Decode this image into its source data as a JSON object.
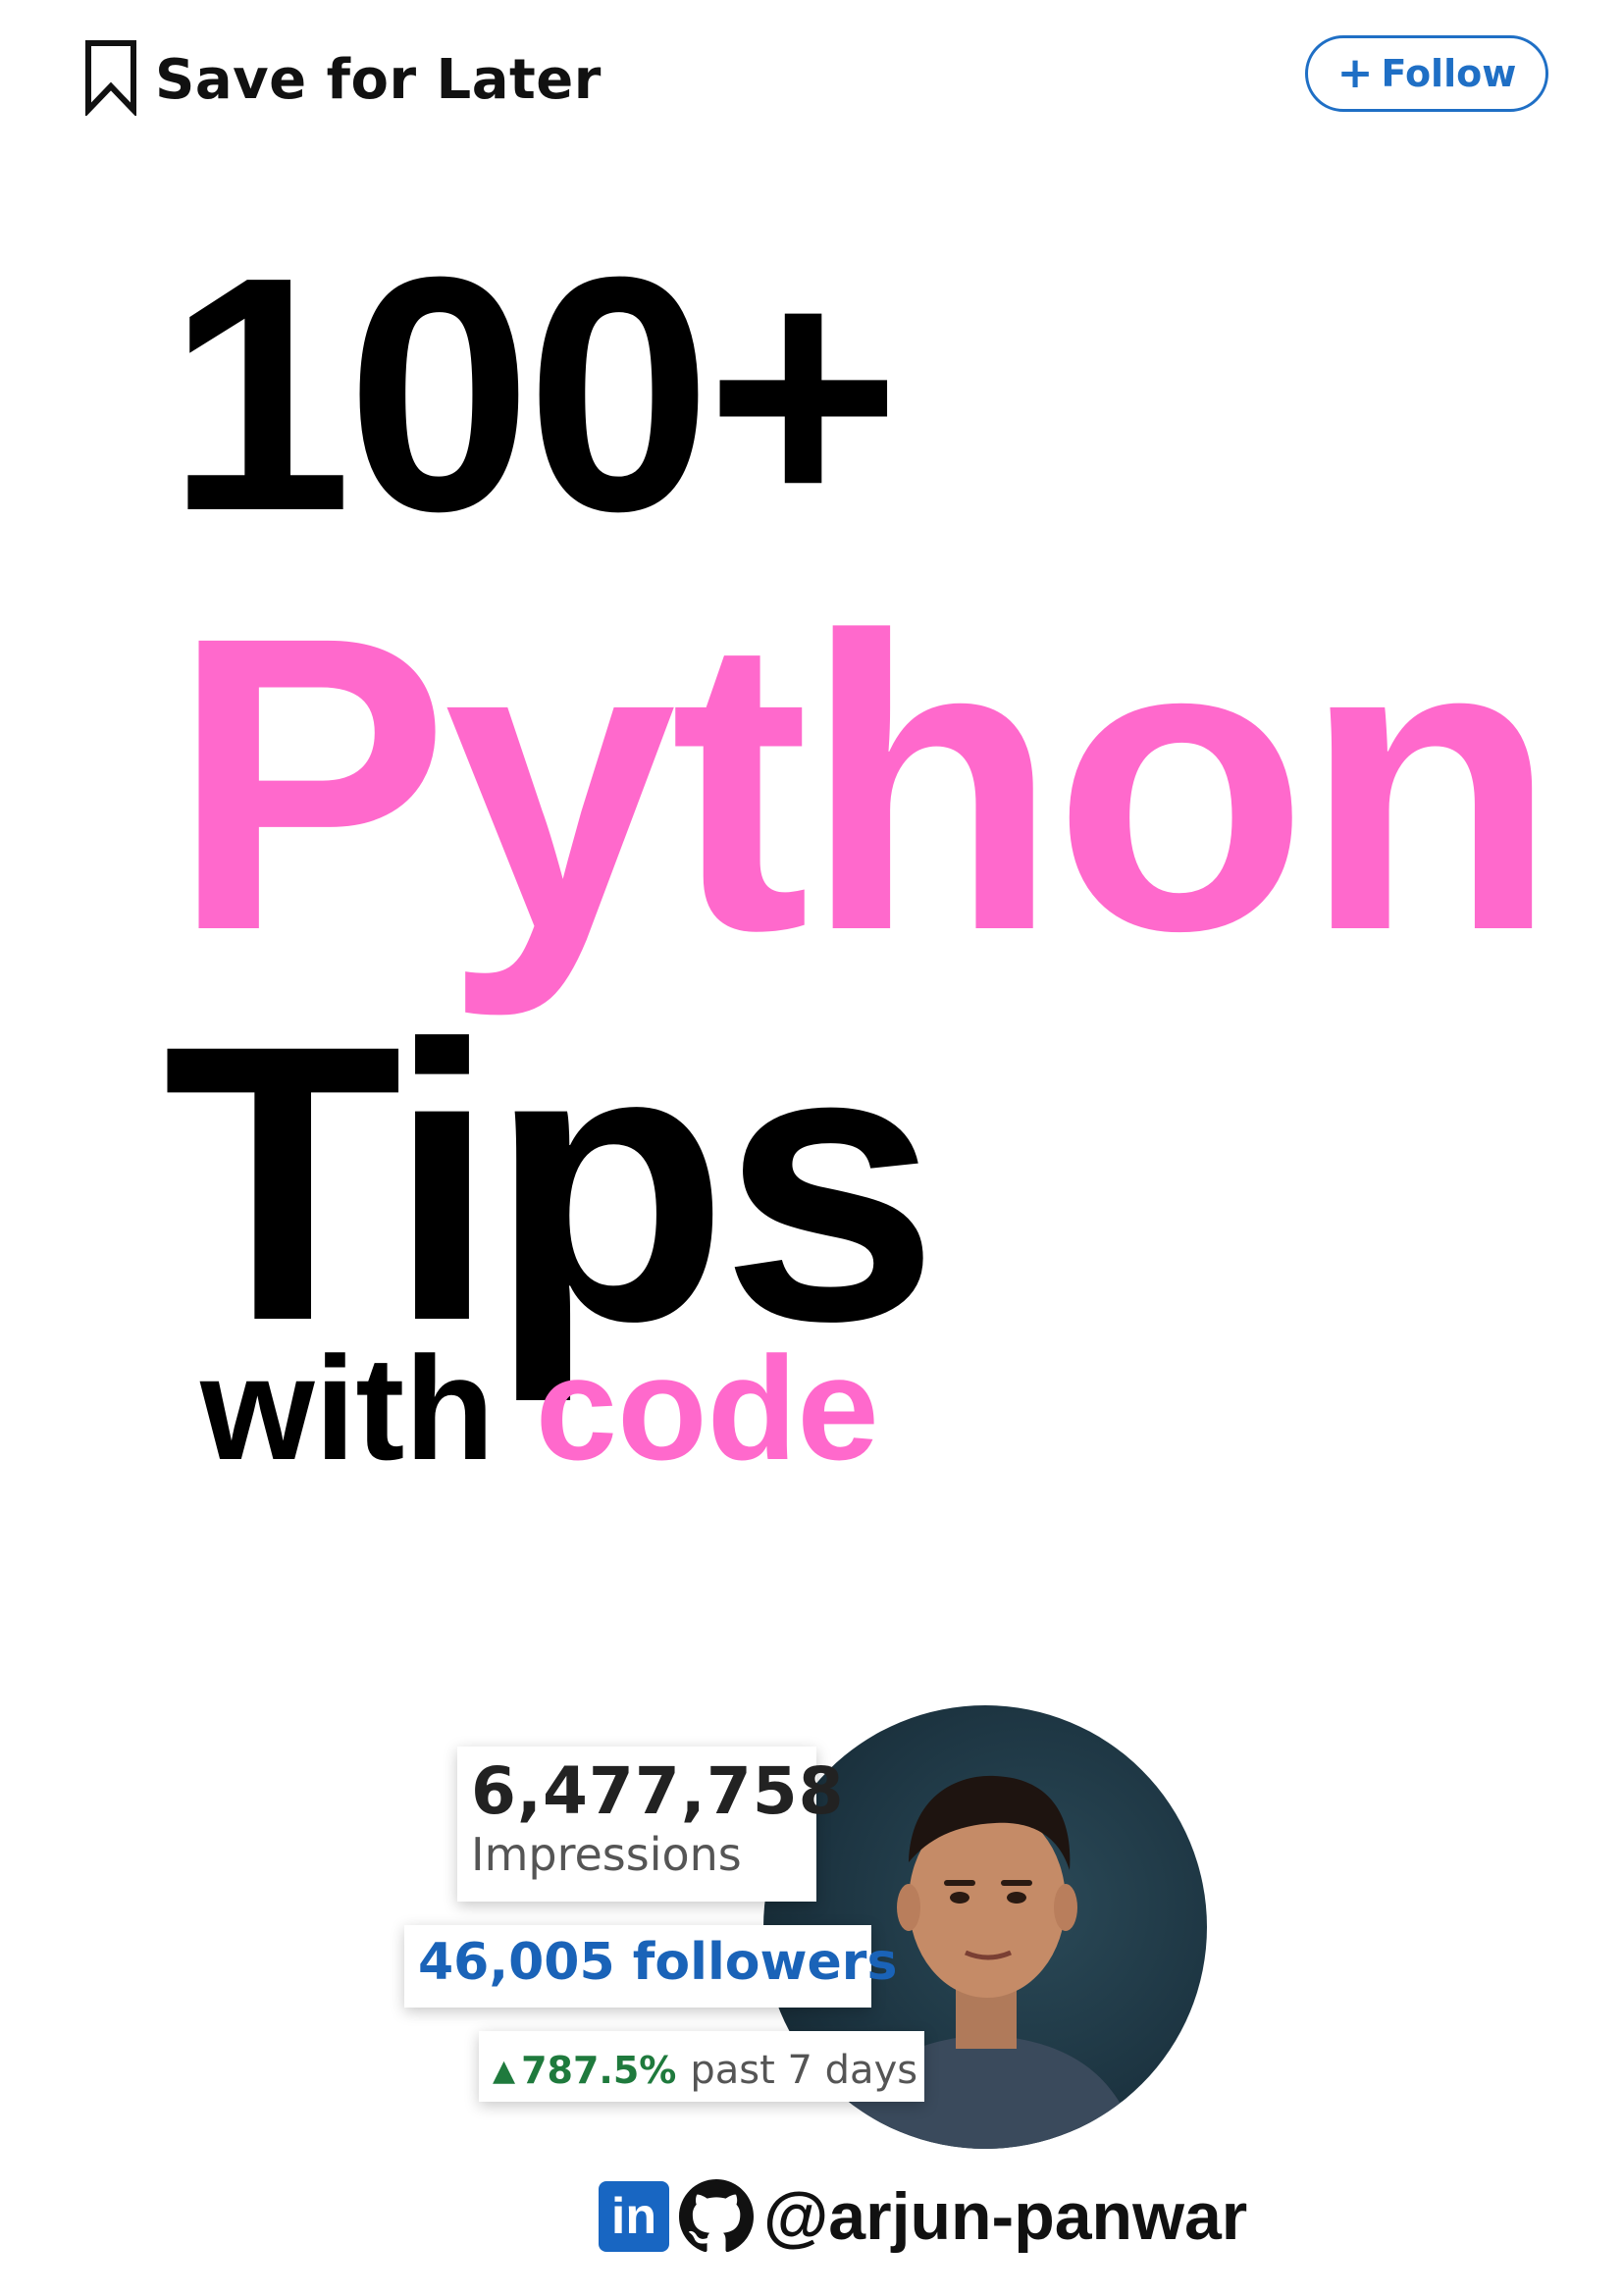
{
  "header": {
    "save_label": "Save for Later",
    "follow_label": "Follow",
    "follow_icon": "+",
    "bookmark_icon": "bookmark-icon",
    "accent_color": "#1f6fc5"
  },
  "headline": {
    "line1": "100+",
    "line2": "Python",
    "line3": "Tips",
    "line4_prefix": "with",
    "line4_accent": "code",
    "pink_color": "#ff69cc"
  },
  "stats": {
    "impressions_value": "6,477,758",
    "impressions_label": "Impressions",
    "followers_text": "46,005 followers",
    "growth_arrow": "▲",
    "growth_value": "787.5%",
    "growth_period": "past 7 days",
    "growth_color": "#1f7a3d",
    "followers_color": "#1a63b8"
  },
  "footer": {
    "linkedin_icon_text": "in",
    "handle": "@arjun-panwar",
    "icons": [
      "linkedin-icon",
      "github-icon"
    ]
  }
}
